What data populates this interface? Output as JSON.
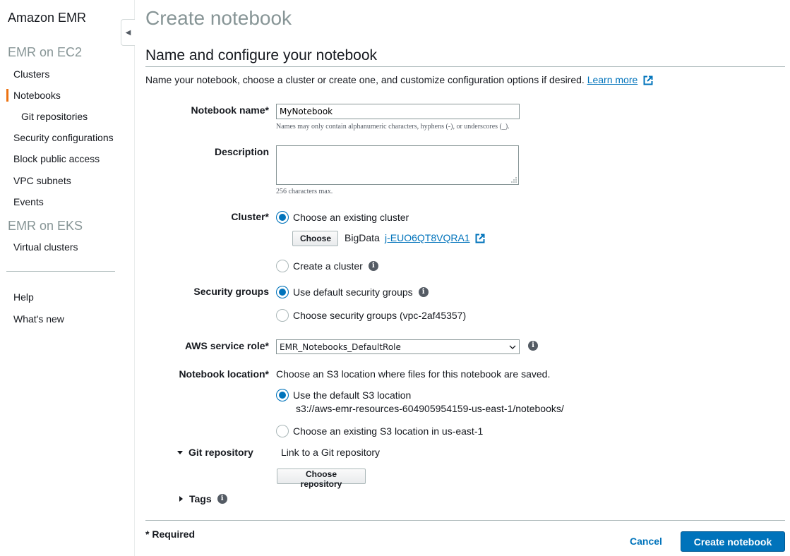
{
  "sidebar": {
    "brand": "Amazon EMR",
    "sections": [
      {
        "title": "EMR on EC2"
      },
      {
        "title": "EMR on EKS"
      }
    ],
    "ec2_items": [
      "Clusters",
      "Notebooks",
      "Git repositories",
      "Security configurations",
      "Block public access",
      "VPC subnets",
      "Events"
    ],
    "eks_items": [
      "Virtual clusters"
    ],
    "footer_items": [
      "Help",
      "What's new"
    ],
    "active_item": "Notebooks"
  },
  "page": {
    "title": "Create notebook",
    "section_heading": "Name and configure your notebook",
    "intro": "Name your notebook, choose a cluster or create one, and customize configuration options if desired.",
    "learn_more": "Learn more"
  },
  "form": {
    "notebook_name": {
      "label": "Notebook name*",
      "value": "MyNotebook",
      "hint": "Names may only contain alphanumeric characters, hyphens (-), or underscores (_)."
    },
    "description": {
      "label": "Description",
      "value": "",
      "hint": "256 characters max."
    },
    "cluster": {
      "label": "Cluster*",
      "options": [
        "Choose an existing cluster",
        "Create a cluster"
      ],
      "selected": "Choose an existing cluster",
      "choose_button": "Choose",
      "cluster_name": "BigData",
      "cluster_id": "j-EUO6QT8VQRA1"
    },
    "security_groups": {
      "label": "Security groups",
      "options": [
        "Use default security groups",
        "Choose security groups (vpc-2af45357)"
      ],
      "selected": "Use default security groups"
    },
    "service_role": {
      "label": "AWS service role*",
      "value": "EMR_Notebooks_DefaultRole"
    },
    "notebook_location": {
      "label": "Notebook location*",
      "description": "Choose an S3 location where files for this notebook are saved.",
      "options": [
        "Use the default S3 location",
        "Choose an existing S3 location in us-east-1"
      ],
      "default_path": "s3://aws-emr-resources-604905954159-us-east-1/notebooks/",
      "selected": "Use the default S3 location"
    },
    "git_repository": {
      "label": "Git repository",
      "description": "Link to a Git repository",
      "button": "Choose repository"
    },
    "tags": {
      "label": "Tags"
    }
  },
  "footer": {
    "required_note": "* Required",
    "cancel": "Cancel",
    "submit": "Create notebook"
  },
  "colors": {
    "accent": "#0073bb",
    "active_nav": "#ec7211",
    "muted": "#879596"
  },
  "icons": [
    "collapse-sidebar-icon",
    "external-link-icon",
    "info-icon",
    "resize-grip-icon",
    "chevron-down-icon",
    "caret-down-icon",
    "caret-right-icon"
  ]
}
